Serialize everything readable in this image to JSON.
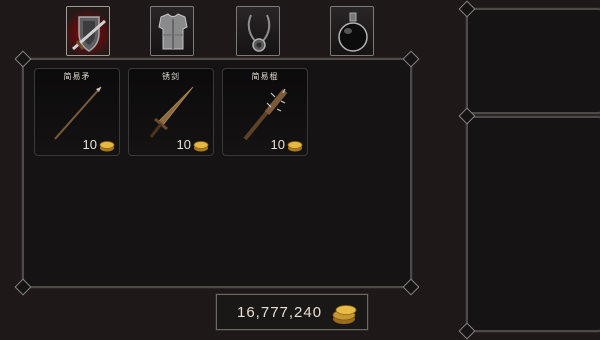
{
  "tabs": [
    {
      "name": "weapons",
      "icon": "sword-shield-icon",
      "active": true
    },
    {
      "name": "armor",
      "icon": "chest-armor-icon",
      "active": false
    },
    {
      "name": "accessories",
      "icon": "necklace-icon",
      "active": false
    },
    {
      "name": "potions",
      "icon": "potion-flask-icon",
      "active": false
    }
  ],
  "shop": {
    "items": [
      {
        "name": "简易矛",
        "price": "10",
        "icon": "spear-icon"
      },
      {
        "name": "锈剑",
        "price": "10",
        "icon": "rusty-sword-icon"
      },
      {
        "name": "简易棍",
        "price": "10",
        "icon": "spiked-club-icon"
      }
    ]
  },
  "wallet": {
    "gold": "16,777,240",
    "icon": "gold-coins-icon"
  },
  "colors": {
    "accent_red": "#8a1818",
    "gold": "#d8a83a",
    "frame": "#4e4a48"
  }
}
